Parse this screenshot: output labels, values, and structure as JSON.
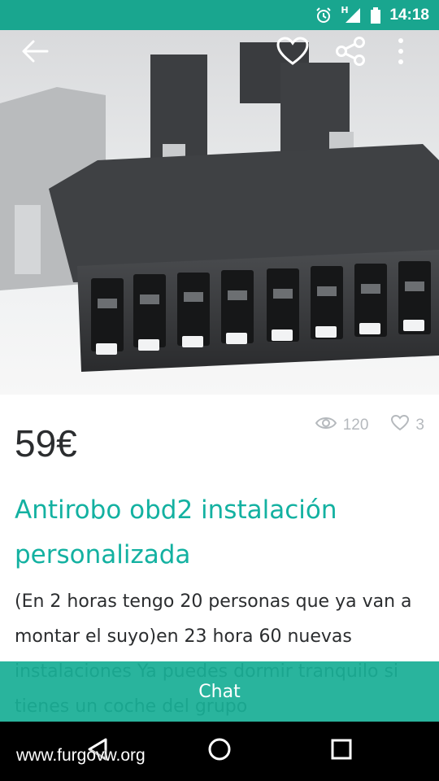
{
  "status_bar": {
    "time": "14:18",
    "icons": [
      "alarm-icon",
      "signal-icon",
      "battery-icon"
    ],
    "network_label": "H"
  },
  "toolbar": {
    "icons": [
      "back-arrow-icon",
      "heart-icon",
      "share-icon",
      "more-vert-icon"
    ]
  },
  "product": {
    "price": "59€",
    "views": "120",
    "favorites": "3",
    "title": "Antirobo obd2 instalación personalizada",
    "description": "(En 2 horas tengo 20 personas que ya van a montar el suyo)en 23 hora 60 nuevas instalaciones Ya puedes dormir tranquilo si tienes un coche del grupo"
  },
  "chat": {
    "label": "Chat"
  },
  "nav_bar": {
    "icons": [
      "back-triangle-icon",
      "home-circle-icon",
      "recents-square-icon"
    ]
  },
  "watermark": "www.furgovw.org",
  "colors": {
    "accent": "#13b1a1",
    "status_bar": "#19a68f",
    "chat_button": "#19ae96",
    "text": "#2b2d2f",
    "muted": "#b5b9bd"
  }
}
